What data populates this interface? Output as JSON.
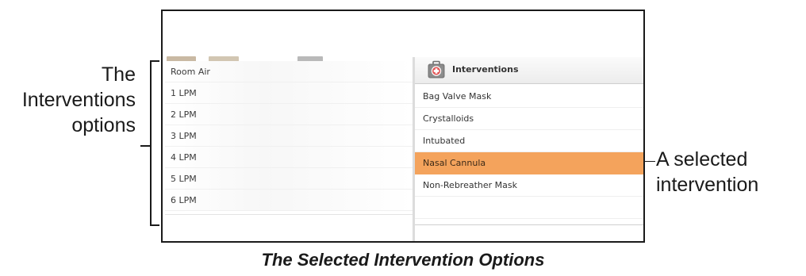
{
  "oxygen_options": [
    "Room Air",
    "1 LPM",
    "2 LPM",
    "3 LPM",
    "4 LPM",
    "5 LPM",
    "6 LPM"
  ],
  "interventions_panel": {
    "title": "Interventions",
    "icon": "medical-kit-icon",
    "items": [
      "Bag Valve Mask",
      "Crystalloids",
      "Intubated",
      "Nasal Cannula",
      "Non-Rebreather Mask",
      ""
    ],
    "selected_item": "Nasal Cannula"
  },
  "annotations": {
    "left_label_lines": [
      "The",
      "Interventions",
      "options"
    ],
    "right_label_lines": [
      "A selected",
      "intervention"
    ]
  },
  "caption": "The Selected Intervention Options",
  "colors": {
    "selected_highlight": "#f4a35c",
    "frame_border": "#1a1a1a"
  }
}
